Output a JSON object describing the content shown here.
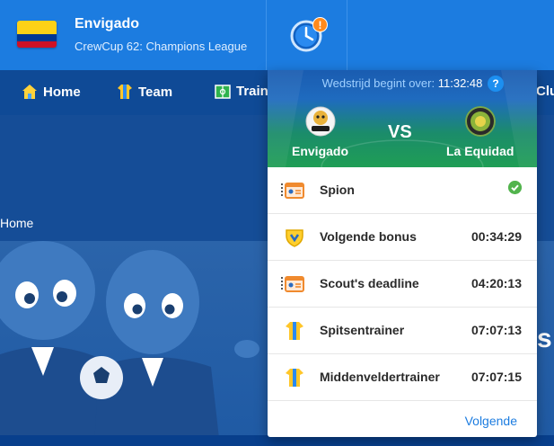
{
  "header": {
    "club_name": "Envigado",
    "league": "CrewCup 62: Champions League",
    "notification_badge": "!"
  },
  "nav": {
    "items": [
      {
        "label": "Home",
        "icon": "home-icon"
      },
      {
        "label": "Team",
        "icon": "jersey-icon"
      },
      {
        "label": "Traini",
        "icon": "training-icon"
      },
      {
        "label": "Clu",
        "icon": ""
      }
    ]
  },
  "page": {
    "breadcrumb": "Home",
    "side_text": "s"
  },
  "popup": {
    "countdown_label": "Wedstrijd begint over:",
    "countdown_time": "11:32:48",
    "help": "?",
    "home_team": "Envigado",
    "away_team": "La Equidad",
    "vs": "VS",
    "items": [
      {
        "label": "Spion",
        "value": "",
        "icon": "id-card-icon",
        "done": true
      },
      {
        "label": "Volgende bonus",
        "value": "00:34:29",
        "icon": "bonus-shield-icon",
        "done": false
      },
      {
        "label": "Scout's deadline",
        "value": "04:20:13",
        "icon": "id-card-icon",
        "done": false
      },
      {
        "label": "Spitsentrainer",
        "value": "07:07:13",
        "icon": "jersey-icon",
        "done": false
      },
      {
        "label": "Middenveldertrainer",
        "value": "07:07:15",
        "icon": "jersey-icon",
        "done": false
      }
    ],
    "next_link": "Volgende"
  },
  "colors": {
    "header_blue": "#1c7ce0",
    "nav_blue": "#0f4a96",
    "link_blue": "#1c7ce0",
    "check_green": "#52b44d"
  }
}
